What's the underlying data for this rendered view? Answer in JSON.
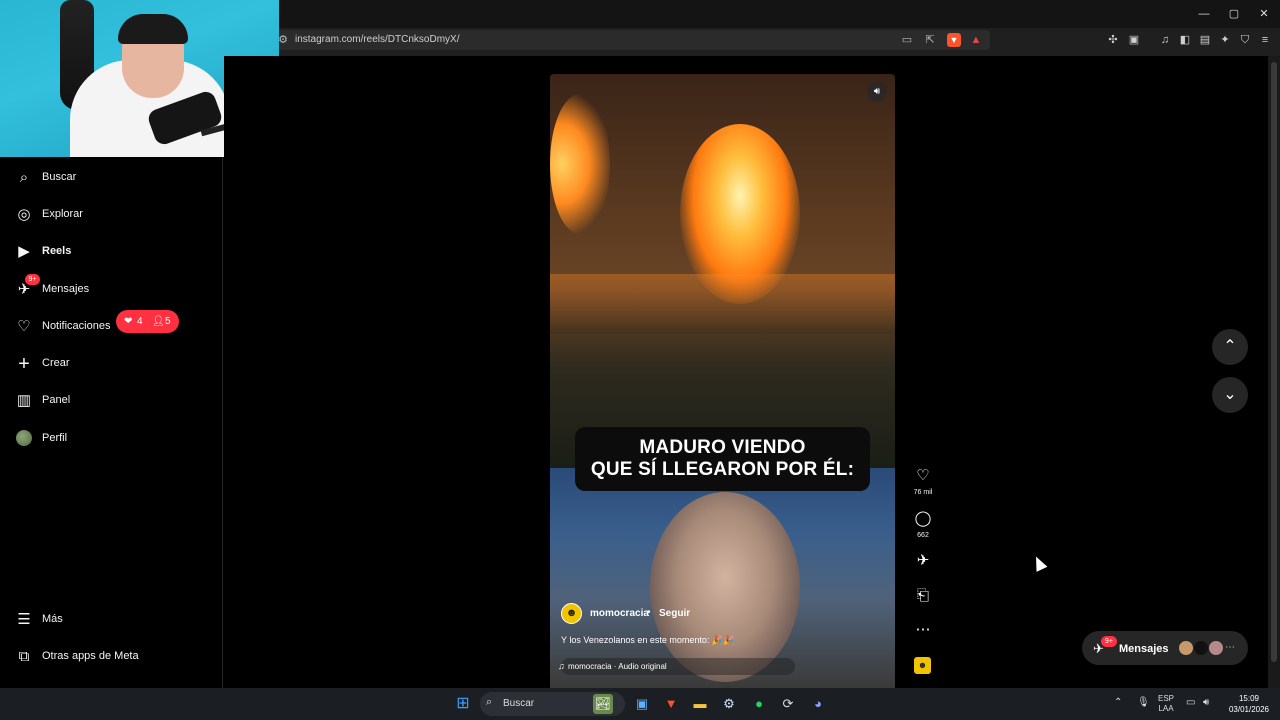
{
  "browser": {
    "url": "instagram.com/reels/DTCnksoDmyX/",
    "window_controls": {
      "minimize": "—",
      "maximize": "▢",
      "close": "✕"
    }
  },
  "sidebar": {
    "items": [
      {
        "label": "Buscar",
        "icon": "search-icon",
        "glyph": "⌕",
        "bold": false
      },
      {
        "label": "Explorar",
        "icon": "compass-icon",
        "glyph": "◎",
        "bold": false
      },
      {
        "label": "Reels",
        "icon": "reels-icon",
        "glyph": "▶",
        "bold": true
      },
      {
        "label": "Mensajes",
        "icon": "messenger-icon",
        "glyph": "✈",
        "bold": false,
        "badge": "9+"
      },
      {
        "label": "Notificaciones",
        "icon": "heart-icon",
        "glyph": "♡",
        "bold": false
      },
      {
        "label": "Crear",
        "icon": "plus-icon",
        "glyph": "+",
        "bold": false
      },
      {
        "label": "Panel",
        "icon": "chart-icon",
        "glyph": "▥",
        "bold": false
      },
      {
        "label": "Perfil",
        "icon": "avatar",
        "glyph": "",
        "bold": false
      }
    ],
    "notifications_pill": {
      "likes": "4",
      "followers": "5"
    },
    "bottom_items": [
      {
        "label": "Más",
        "icon": "hamburger-icon",
        "glyph": "☰"
      },
      {
        "label": "Otras apps de Meta",
        "icon": "meta-apps-icon",
        "glyph": "⧉"
      }
    ]
  },
  "reel": {
    "caption_line1": "MADURO VIENDO",
    "caption_line2": "QUE SÍ LLEGARON POR ÉL:",
    "author": "momocracia",
    "dot": "•",
    "follow": "Seguir",
    "description": "Y los Venezolanos en este momento: 🎉🎉",
    "audio": "momocracia · Audio original"
  },
  "actions": {
    "likes": "76 mil",
    "comments": "662"
  },
  "messages_pill": {
    "label": "Mensajes",
    "badge": "9+"
  },
  "taskbar": {
    "search_label": "Buscar",
    "lang_top": "ESP",
    "lang_bottom": "LAA",
    "time": "15:09",
    "date": "03/01/2026"
  },
  "colors": {
    "accent_red": "#ff3040",
    "background": "#000000",
    "brave_orange": "#fb542b"
  }
}
